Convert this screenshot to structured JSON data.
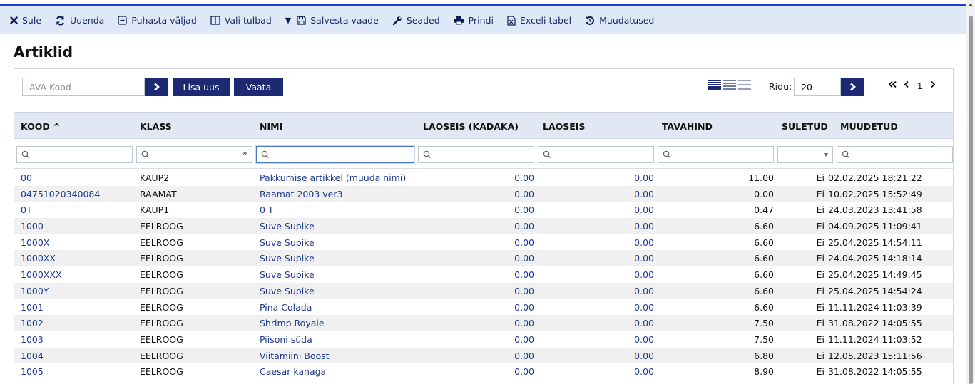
{
  "toolbar": {
    "items": [
      {
        "label": "Sule",
        "icon": "close-icon"
      },
      {
        "label": "Uuenda",
        "icon": "refresh-icon"
      },
      {
        "label": "Puhasta väljad",
        "icon": "clear-fields-icon"
      },
      {
        "label": "Vali tulbad",
        "icon": "columns-icon"
      },
      {
        "label": "Salvesta vaade",
        "icon": "save-icon"
      },
      {
        "label": "Seaded",
        "icon": "wrench-icon"
      },
      {
        "label": "Prindi",
        "icon": "print-icon"
      },
      {
        "label": "Exceli tabel",
        "icon": "excel-icon"
      },
      {
        "label": "Muudatused",
        "icon": "history-icon"
      }
    ],
    "color": "#dfe8f7",
    "accent": "#1f3fc2"
  },
  "page": {
    "title": "Artiklid"
  },
  "controls": {
    "ava_placeholder": "AVA Kood",
    "lisa_uus_label": "Lisa uus",
    "vaata_label": "Vaata",
    "ridu_label": "Ridu:",
    "ridu_value": "20",
    "page_number": "1",
    "button_color": "#1c2a73"
  },
  "columns": [
    {
      "key": "kood",
      "label": "KOOD ^"
    },
    {
      "key": "klass",
      "label": "KLASS"
    },
    {
      "key": "nimi",
      "label": "NIMI"
    },
    {
      "key": "laoseis_kadaka",
      "label": "LAOSEIS (KADAKA)"
    },
    {
      "key": "laoseis",
      "label": "LAOSEIS"
    },
    {
      "key": "tavahind",
      "label": "TAVAHIND"
    },
    {
      "key": "suletud",
      "label": "SULETUD"
    },
    {
      "key": "muudetud",
      "label": "MUUDETUD"
    }
  ],
  "rows": [
    {
      "kood": "00",
      "klass": "KAUP2",
      "nimi": "Pakkumise artikkel (muuda nimi)",
      "laoseis_kadaka": "0.00",
      "laoseis": "0.00",
      "tavahind": "11.00",
      "suletud": "Ei",
      "muudetud": "02.02.2025 18:21:22"
    },
    {
      "kood": "04751020340084",
      "klass": "RAAMAT",
      "nimi": "Raamat 2003 ver3",
      "laoseis_kadaka": "0.00",
      "laoseis": "0.00",
      "tavahind": "0.00",
      "suletud": "Ei",
      "muudetud": "10.02.2025 15:52:49"
    },
    {
      "kood": "0T",
      "klass": "KAUP1",
      "nimi": "0 T",
      "laoseis_kadaka": "0.00",
      "laoseis": "0.00",
      "tavahind": "0.47",
      "suletud": "Ei",
      "muudetud": "24.03.2023 13:41:58"
    },
    {
      "kood": "1000",
      "klass": "EELROOG",
      "nimi": "Suve Supike",
      "laoseis_kadaka": "0.00",
      "laoseis": "0.00",
      "tavahind": "6.60",
      "suletud": "Ei",
      "muudetud": "04.09.2025 11:09:41"
    },
    {
      "kood": "1000X",
      "klass": "EELROOG",
      "nimi": "Suve Supike",
      "laoseis_kadaka": "0.00",
      "laoseis": "0.00",
      "tavahind": "6.60",
      "suletud": "Ei",
      "muudetud": "25.04.2025 14:54:11"
    },
    {
      "kood": "1000XX",
      "klass": "EELROOG",
      "nimi": "Suve Supike",
      "laoseis_kadaka": "0.00",
      "laoseis": "0.00",
      "tavahind": "6.60",
      "suletud": "Ei",
      "muudetud": "24.04.2025 14:18:14"
    },
    {
      "kood": "1000XXX",
      "klass": "EELROOG",
      "nimi": "Suve Supike",
      "laoseis_kadaka": "0.00",
      "laoseis": "0.00",
      "tavahind": "6.60",
      "suletud": "Ei",
      "muudetud": "25.04.2025 14:49:45"
    },
    {
      "kood": "1000Y",
      "klass": "EELROOG",
      "nimi": "Suve Supike",
      "laoseis_kadaka": "0.00",
      "laoseis": "0.00",
      "tavahind": "6.60",
      "suletud": "Ei",
      "muudetud": "25.04.2025 14:54:24"
    },
    {
      "kood": "1001",
      "klass": "EELROOG",
      "nimi": "Pina Colada",
      "laoseis_kadaka": "0.00",
      "laoseis": "0.00",
      "tavahind": "6.60",
      "suletud": "Ei",
      "muudetud": "11.11.2024 11:03:39"
    },
    {
      "kood": "1002",
      "klass": "EELROOG",
      "nimi": "Shrimp Royale",
      "laoseis_kadaka": "0.00",
      "laoseis": "0.00",
      "tavahind": "7.50",
      "suletud": "Ei",
      "muudetud": "31.08.2022 14:05:55"
    },
    {
      "kood": "1003",
      "klass": "EELROOG",
      "nimi": "Piisoni süda",
      "laoseis_kadaka": "0.00",
      "laoseis": "0.00",
      "tavahind": "7.50",
      "suletud": "Ei",
      "muudetud": "11.11.2024 11:03:52"
    },
    {
      "kood": "1004",
      "klass": "EELROOG",
      "nimi": "Viitamiini Boost",
      "laoseis_kadaka": "0.00",
      "laoseis": "0.00",
      "tavahind": "6.80",
      "suletud": "Ei",
      "muudetud": "12.05.2023 15:11:56"
    },
    {
      "kood": "1005",
      "klass": "EELROOG",
      "nimi": "Caesar kanaga",
      "laoseis_kadaka": "0.00",
      "laoseis": "0.00",
      "tavahind": "8.90",
      "suletud": "Ei",
      "muudetud": "31.08.2022 14:05:55"
    }
  ]
}
